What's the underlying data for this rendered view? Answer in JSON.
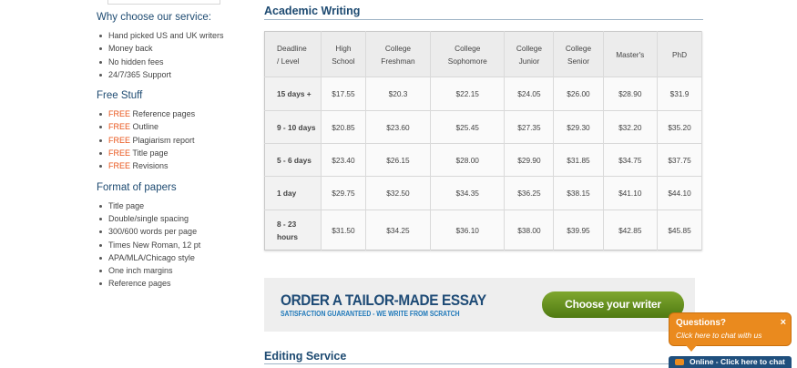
{
  "sidebar": {
    "why": {
      "heading": "Why choose our service:",
      "items": [
        "Hand picked US and UK writers",
        "Money back",
        "No hidden fees",
        "24/7/365 Support"
      ]
    },
    "free": {
      "heading": "Free Stuff",
      "free_word": "FREE",
      "items": [
        "Reference pages",
        "Outline",
        "Plagiarism report",
        "Title page",
        "Revisions"
      ]
    },
    "format": {
      "heading": "Format of papers",
      "items": [
        "Title page",
        "Double/single spacing",
        "300/600 words per page",
        "Times New Roman, 12 pt",
        "APA/MLA/Chicago style",
        "One inch margins",
        "Reference pages"
      ]
    }
  },
  "academic": {
    "title": "Academic Writing",
    "headers": [
      [
        "Deadline",
        "/ Level"
      ],
      [
        "High",
        "School"
      ],
      [
        "College",
        "Freshman"
      ],
      [
        "College",
        "Sophomore"
      ],
      [
        "College",
        "Junior"
      ],
      [
        "College",
        "Senior"
      ],
      [
        "Master's"
      ],
      [
        "PhD"
      ]
    ],
    "rows": [
      {
        "deadline": [
          "15 days +"
        ],
        "prices": [
          "$17.55",
          "$20.3",
          "$22.15",
          "$24.05",
          "$26.00",
          "$28.90",
          "$31.9"
        ]
      },
      {
        "deadline": [
          "9 - 10 days"
        ],
        "prices": [
          "$20.85",
          "$23.60",
          "$25.45",
          "$27.35",
          "$29.30",
          "$32.20",
          "$35.20"
        ]
      },
      {
        "deadline": [
          "5 - 6 days"
        ],
        "prices": [
          "$23.40",
          "$26.15",
          "$28.00",
          "$29.90",
          "$31.85",
          "$34.75",
          "$37.75"
        ]
      },
      {
        "deadline": [
          "1 day"
        ],
        "prices": [
          "$29.75",
          "$32.50",
          "$34.35",
          "$36.25",
          "$38.15",
          "$41.10",
          "$44.10"
        ]
      },
      {
        "deadline": [
          "8 - 23",
          "hours"
        ],
        "prices": [
          "$31.50",
          "$34.25",
          "$36.10",
          "$38.00",
          "$39.95",
          "$42.85",
          "$45.85"
        ]
      }
    ]
  },
  "banner": {
    "title": "ORDER A TAILOR-MADE ESSAY",
    "subtitle": "SATISFACTION GUARANTEED - WE WRITE FROM SCRATCH",
    "cta": "Choose your writer"
  },
  "editing": {
    "title": "Editing Service"
  },
  "chat": {
    "question": "Questions?",
    "subtitle": "Click here to chat with us",
    "close": "×",
    "online": "Online - Click here to chat"
  },
  "colors": {
    "heading": "#1d4a71",
    "free": "#e8541a",
    "cta": "#5f8a1c",
    "chat": "#ea8a1e",
    "chat_bar": "#1f4f7d"
  }
}
